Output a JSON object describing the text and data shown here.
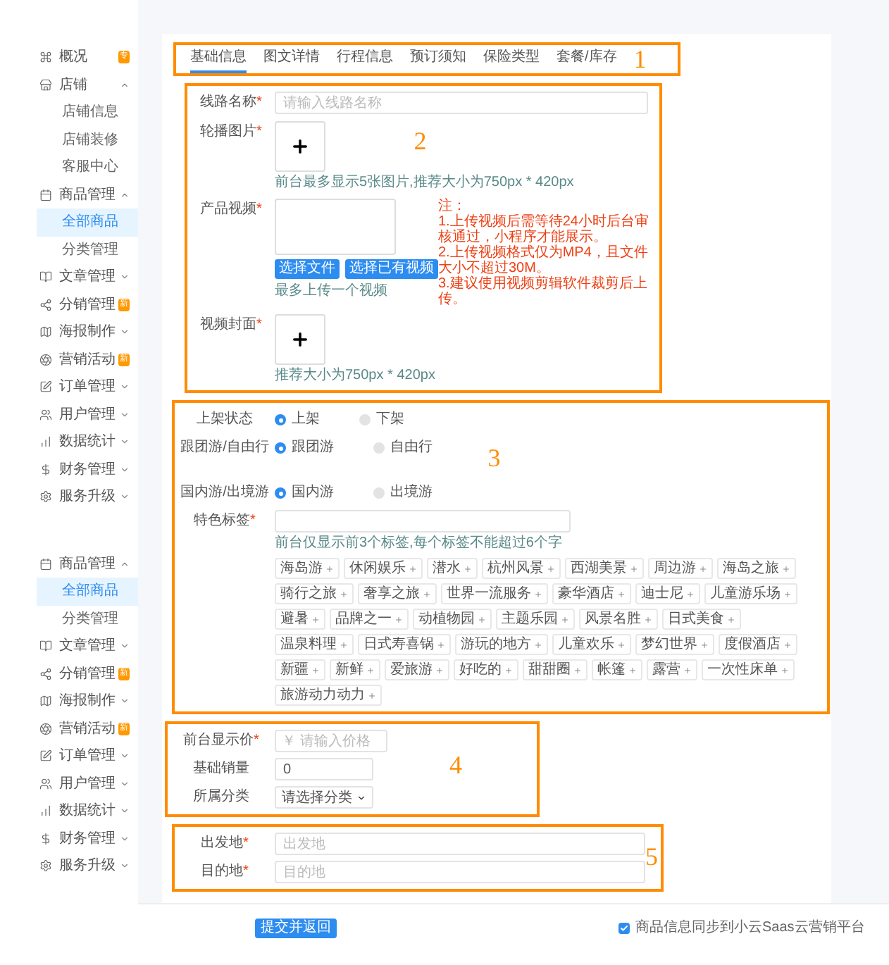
{
  "sidebar_top": {
    "items": [
      {
        "kind": "badge",
        "label": "概况",
        "badge": "专"
      },
      {
        "kind": "group",
        "label": "店铺",
        "expanded": true
      },
      {
        "kind": "sub",
        "label": "店铺信息",
        "selected": false
      },
      {
        "kind": "sub",
        "label": "店铺装修",
        "selected": false
      },
      {
        "kind": "sub",
        "label": "客服中心",
        "selected": false
      },
      {
        "kind": "group",
        "label": "商品管理",
        "expanded": true
      },
      {
        "kind": "sub",
        "label": "全部商品",
        "selected": true
      },
      {
        "kind": "sub",
        "label": "分类管理",
        "selected": false
      },
      {
        "kind": "group",
        "label": "文章管理",
        "expanded": false
      },
      {
        "kind": "badge",
        "label": "分销管理",
        "badge": "新"
      },
      {
        "kind": "group",
        "label": "海报制作",
        "expanded": false
      },
      {
        "kind": "badge",
        "label": "营销活动",
        "badge": "新"
      },
      {
        "kind": "group",
        "label": "订单管理",
        "expanded": false
      },
      {
        "kind": "group",
        "label": "用户管理",
        "expanded": false
      },
      {
        "kind": "group",
        "label": "数据统计",
        "expanded": false
      },
      {
        "kind": "group",
        "label": "财务管理",
        "expanded": false
      },
      {
        "kind": "group",
        "label": "服务升级",
        "expanded": false
      }
    ]
  },
  "sidebar_bottom": {
    "items": [
      {
        "kind": "group",
        "label": "商品管理",
        "expanded": true
      },
      {
        "kind": "sub",
        "label": "全部商品",
        "selected": true
      },
      {
        "kind": "sub",
        "label": "分类管理",
        "selected": false
      },
      {
        "kind": "group",
        "label": "文章管理",
        "expanded": false
      },
      {
        "kind": "badge",
        "label": "分销管理",
        "badge": "新"
      },
      {
        "kind": "group",
        "label": "海报制作",
        "expanded": false
      },
      {
        "kind": "badge",
        "label": "营销活动",
        "badge": "新"
      },
      {
        "kind": "group",
        "label": "订单管理",
        "expanded": false
      },
      {
        "kind": "group",
        "label": "用户管理",
        "expanded": false
      },
      {
        "kind": "group",
        "label": "数据统计",
        "expanded": false
      },
      {
        "kind": "group",
        "label": "财务管理",
        "expanded": false
      },
      {
        "kind": "group",
        "label": "服务升级",
        "expanded": false
      }
    ]
  },
  "tabs": [
    {
      "label": "基础信息",
      "selected": true
    },
    {
      "label": "图文详情",
      "selected": false
    },
    {
      "label": "行程信息",
      "selected": false
    },
    {
      "label": "预订须知",
      "selected": false
    },
    {
      "label": "保险类型",
      "selected": false
    },
    {
      "label": "套餐/库存",
      "selected": false
    }
  ],
  "form": {
    "route_name": {
      "label": "线路名称",
      "mark": "*",
      "placeholder": "请输入线路名称"
    },
    "carousel": {
      "label": "轮播图片",
      "mark": "*",
      "hint": "前台最多显示5张图片,推荐大小为750px * 420px"
    },
    "video": {
      "label": "产品视频",
      "mark": "*",
      "notes": [
        "注：",
        "1.上传视频后需等待24小时后台审核通过，小程序才能展示。",
        "2.上传视频格式仅为MP4，且文件大小不超过30M。",
        "3.建议使用视频剪辑软件裁剪后上传。"
      ],
      "buttons": [
        "选择文件",
        "选择已有视频"
      ],
      "hint": "最多上传一个视频"
    },
    "cover": {
      "label": "视频封面",
      "mark": "*",
      "hint": "推荐大小为750px * 420px"
    },
    "listing_status": {
      "label": "上架状态",
      "options": [
        {
          "label": "上架",
          "selected": true
        },
        {
          "label": "下架",
          "selected": false
        }
      ]
    },
    "tour_type": {
      "label": "跟团游/自由行",
      "options": [
        {
          "label": "跟团游",
          "selected": true
        },
        {
          "label": "自由行",
          "selected": false
        }
      ]
    },
    "region": {
      "label": "国内游/出境游",
      "options": [
        {
          "label": "国内游",
          "selected": true
        },
        {
          "label": "出境游",
          "selected": false
        }
      ]
    },
    "feature_tags": {
      "label": "特色标签",
      "mark": "*",
      "hint": "前台仅显示前3个标签,每个标签不能超过6个字",
      "tags": [
        "海岛游",
        "休闲娱乐",
        "潜水",
        "杭州风景",
        "西湖美景",
        "周边游",
        "海岛之旅",
        "骑行之旅",
        "奢享之旅",
        "世界一流服务",
        "豪华酒店",
        "迪士尼",
        "儿童游乐场",
        "避暑",
        "品牌之一",
        "动植物园",
        "主题乐园",
        "风景名胜",
        "日式美食",
        "温泉料理",
        "日式寿喜锅",
        "游玩的地方",
        "儿童欢乐",
        "梦幻世界",
        "度假酒店",
        "新疆",
        "新鲜",
        "爱旅游",
        "好吃的",
        "甜甜圈",
        "帐篷",
        "露营",
        "一次性床单",
        "旅游动力动力"
      ]
    },
    "price": {
      "label": "前台显示价",
      "mark": "*",
      "prefix": "￥",
      "placeholder": "请输入价格"
    },
    "base_sales": {
      "label": "基础销量",
      "value": "0"
    },
    "category": {
      "label": "所属分类",
      "value": "请选择分类"
    },
    "departure": {
      "label": "出发地",
      "mark": "*",
      "placeholder": "出发地"
    },
    "destination": {
      "label": "目的地",
      "mark": "*",
      "placeholder": "目的地"
    }
  },
  "footer": {
    "submit": "提交并返回",
    "sync": {
      "label": "商品信息同步到小云Saas云营销平台",
      "checked": true
    }
  },
  "annotations": [
    "1",
    "2",
    "3",
    "4",
    "5"
  ]
}
